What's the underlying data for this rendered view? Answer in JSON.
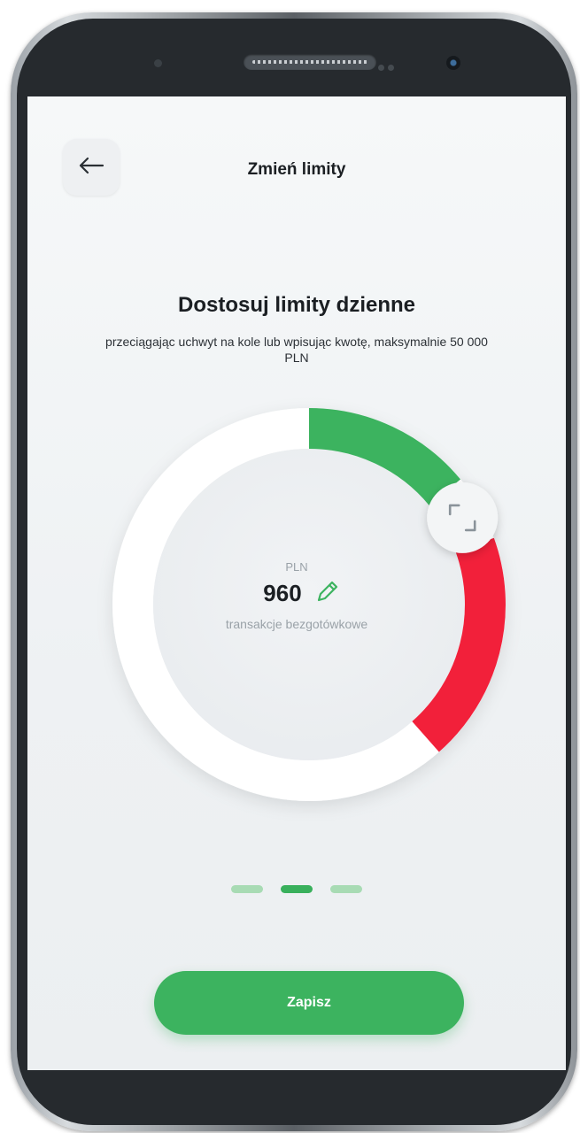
{
  "header": {
    "title": "Zmień limity",
    "back_icon": "arrow-left-icon"
  },
  "intro": {
    "heading": "Dostosuj limity dzienne",
    "description": "przeciągając uchwyt na kole lub wpisując kwotę, maksymalnie 50 000 PLN"
  },
  "dial": {
    "currency": "PLN",
    "value": "960",
    "caption": "transakcje bezgotówkowe",
    "edit_icon": "pencil-icon",
    "handle_icon": "drag-handle-icon",
    "green_share": 0.14,
    "red_share": 0.19,
    "colors": {
      "green": "#3cb35f",
      "red": "#f2203a",
      "track": "#ffffff"
    }
  },
  "pager": {
    "count": 3,
    "active_index": 1,
    "colors": {
      "active": "#39b05c",
      "inactive": "#a8dbb4"
    }
  },
  "footer": {
    "save_label": "Zapisz"
  }
}
